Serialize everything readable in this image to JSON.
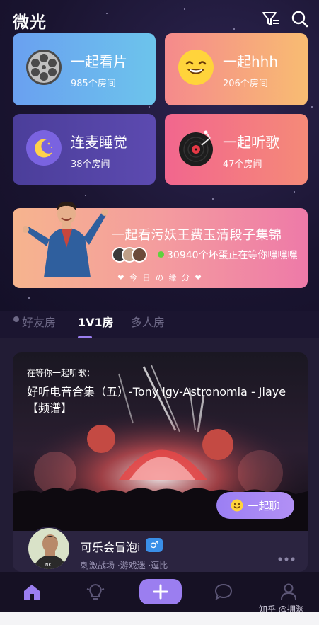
{
  "app": {
    "title": "微光"
  },
  "header": {
    "filter_icon": "filter-icon",
    "search_icon": "search-icon"
  },
  "categories": [
    {
      "title": "一起看片",
      "subtitle": "985个房间",
      "icon": "film-reel-icon",
      "color_start": "#6aa0f0",
      "color_end": "#6cc4ec"
    },
    {
      "title": "一起hhh",
      "subtitle": "206个房间",
      "icon": "laughing-emoji-icon",
      "color_start": "#f58a8c",
      "color_end": "#f8bc72"
    },
    {
      "title": "连麦睡觉",
      "subtitle": "38个房间",
      "icon": "moon-stars-icon",
      "color_start": "#4b3e9a",
      "color_end": "#5c4ab0"
    },
    {
      "title": "一起听歌",
      "subtitle": "47个房间",
      "icon": "vinyl-record-icon",
      "color_start": "#f2668e",
      "color_end": "#f58a78"
    }
  ],
  "banner": {
    "title": "一起看污妖王费玉清段子集锦",
    "online_text": "30940个坏蛋正在等你嘿嘿嘿",
    "footer": "❤ 今 日 の 缘 分 ❤"
  },
  "tabs": [
    {
      "label": "好友房",
      "active": false
    },
    {
      "label": "1V1房",
      "active": true
    },
    {
      "label": "多人房",
      "active": false
    }
  ],
  "room": {
    "label": "在等你一起听歌：",
    "song": "好听电音合集（五）-Tony lgy-Astronomia - Jiaye【频谱】",
    "chat_button": "一起聊",
    "user_name": "可乐会冒泡i",
    "gender": "♂",
    "tags": "刺激战场 ·游戏迷 ·逗比"
  },
  "bottom_nav": [
    {
      "name": "home-icon",
      "active": true
    },
    {
      "name": "lightbulb-icon",
      "active": false
    },
    {
      "name": "plus-icon",
      "active": false
    },
    {
      "name": "chat-bubble-icon",
      "active": false
    },
    {
      "name": "profile-icon",
      "active": false
    }
  ],
  "watermark": "知乎 @拥渊",
  "colors": {
    "accent": "#9b7ef0",
    "online": "#5fd23d",
    "male": "#3a8fe8"
  }
}
